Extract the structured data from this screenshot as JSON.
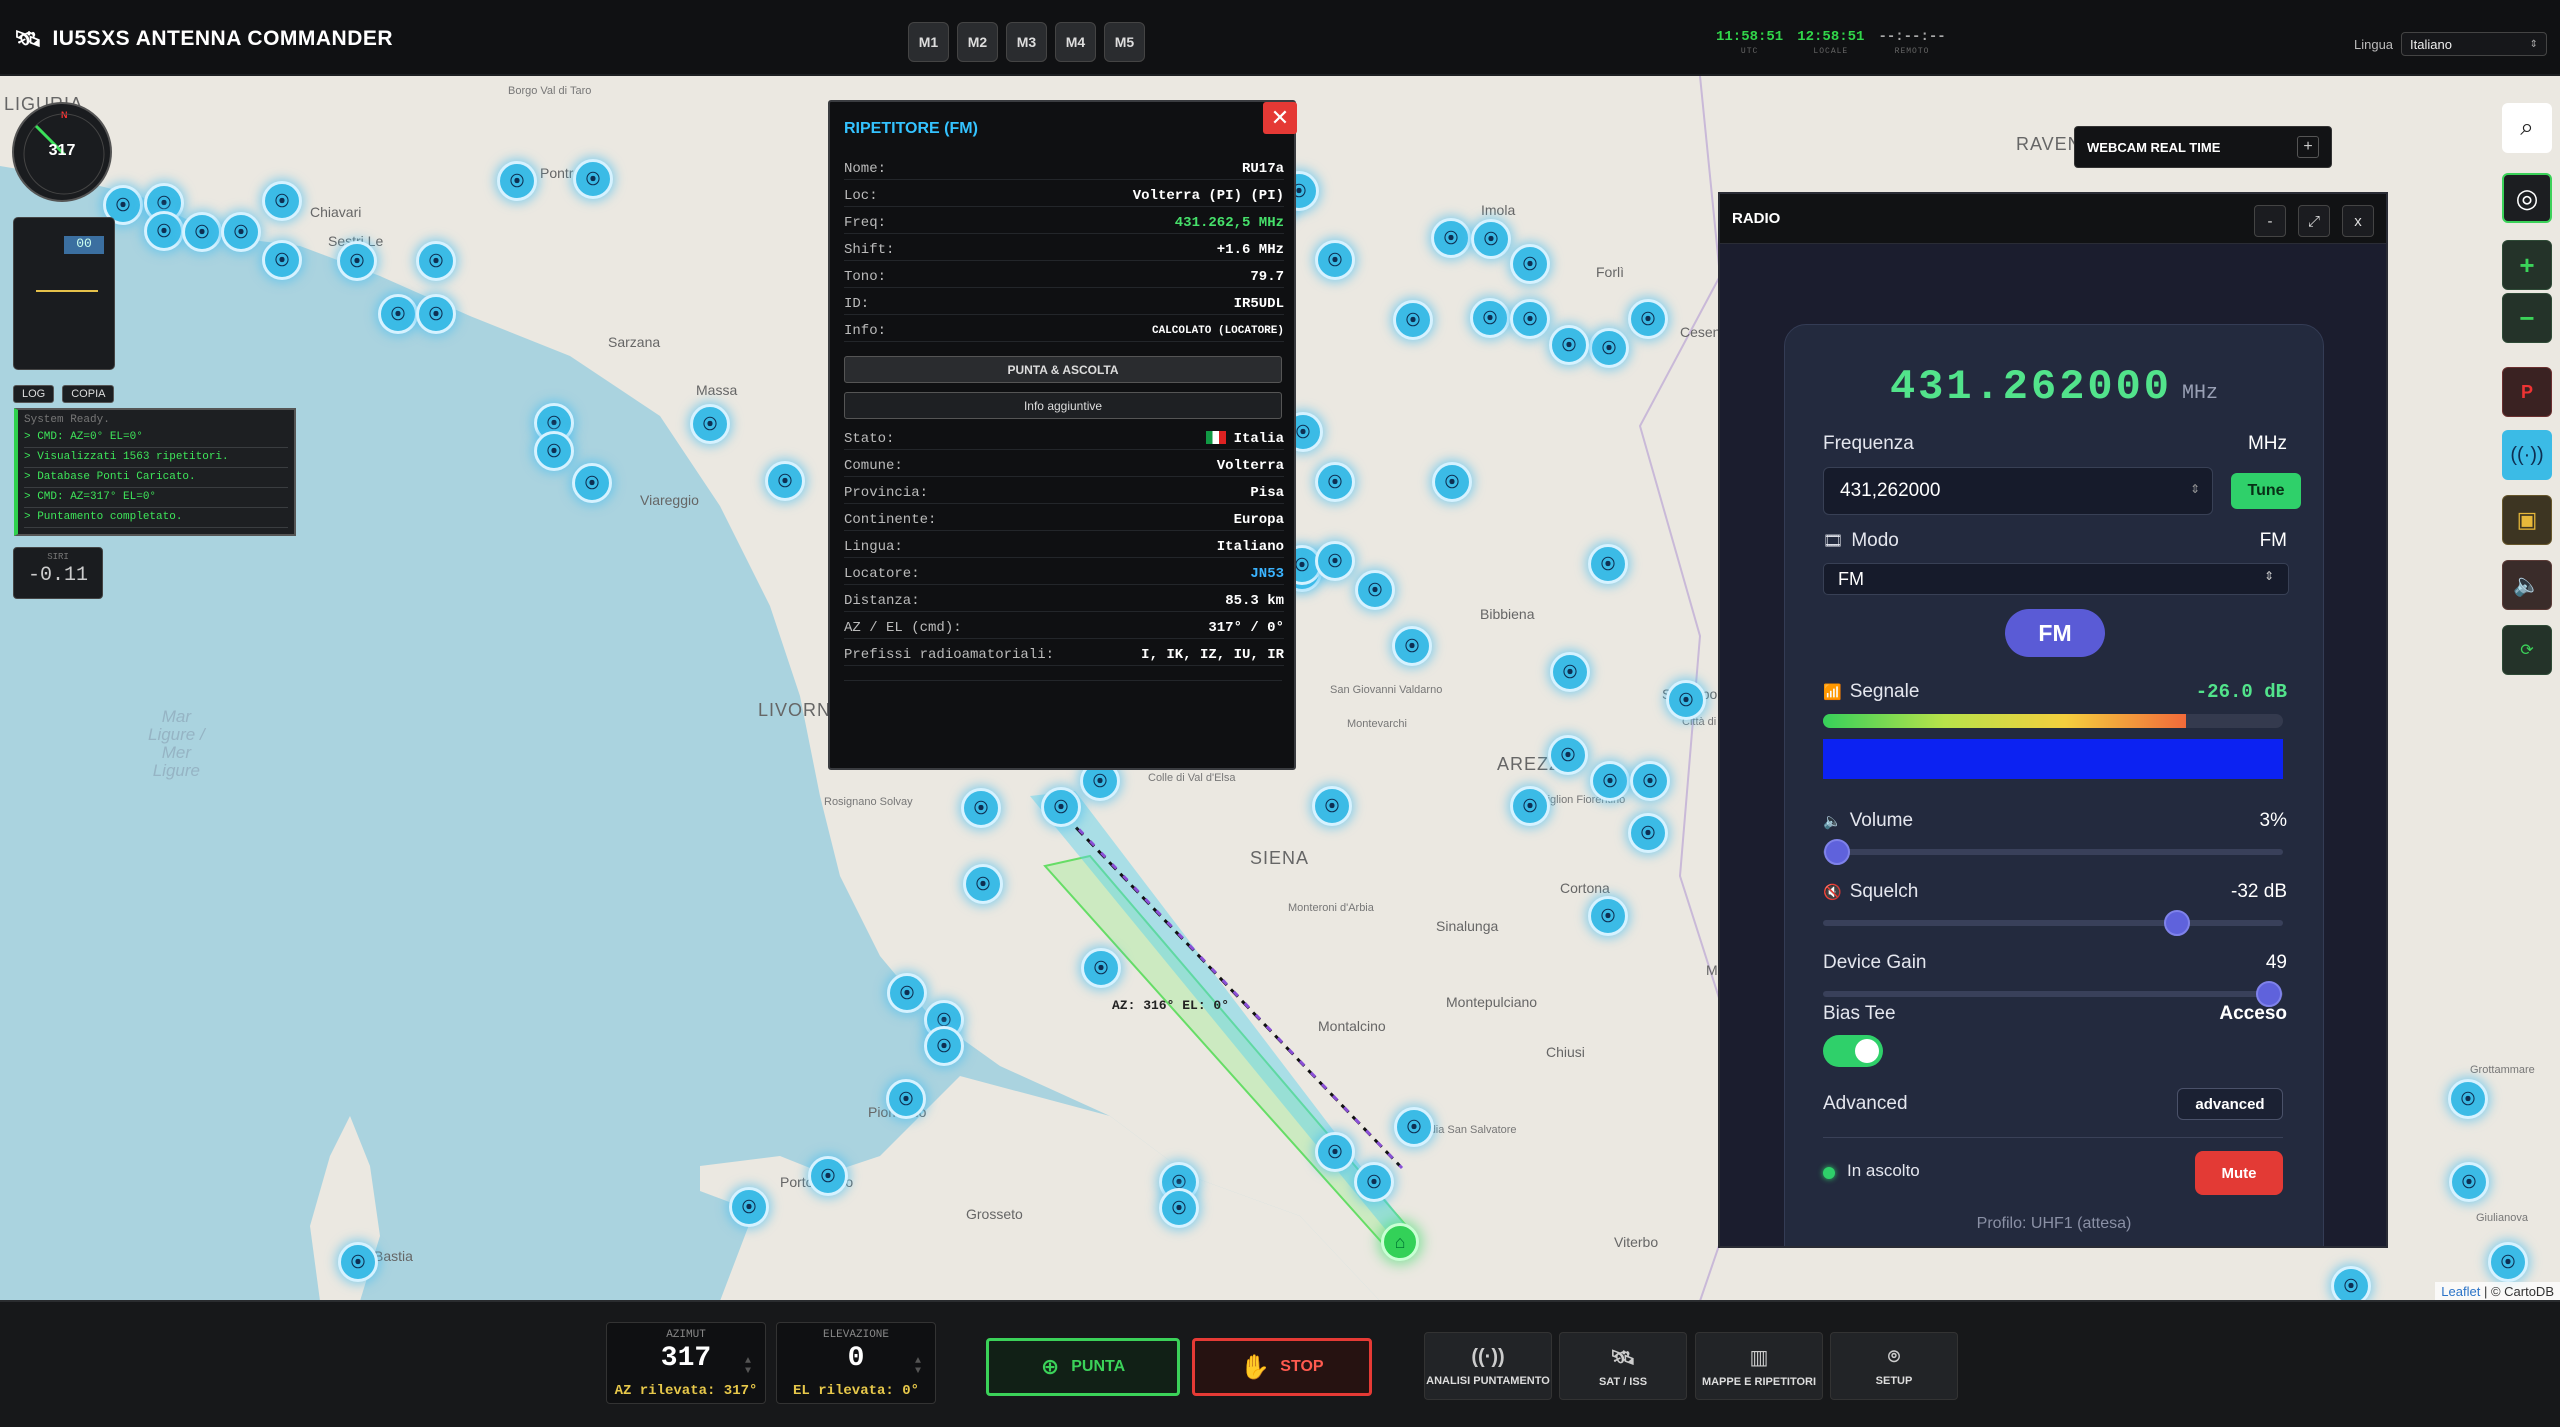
{
  "app": {
    "title": "IU5SXS ANTENNA COMMANDER"
  },
  "memory_buttons": [
    "M1",
    "M2",
    "M3",
    "M4",
    "M5"
  ],
  "clocks": [
    {
      "time": "11:58:51",
      "label": "UTC"
    },
    {
      "time": "12:58:51",
      "label": "LOCALE"
    },
    {
      "time": "--:--:--",
      "label": "REMOTO"
    }
  ],
  "language": {
    "label": "Lingua",
    "value": "Italiano"
  },
  "compass": {
    "azimuth": "317",
    "north": "N"
  },
  "log": {
    "tabs": [
      "LOG",
      "COPIA"
    ],
    "header": "System Ready.",
    "lines": [
      "> CMD: AZ=0° EL=0°",
      "> Visualizzati 1563 ripetitori.",
      "> Database Ponti Caricato.",
      "> CMD: AZ=317° EL=0°",
      "> Puntamento completato."
    ]
  },
  "siri": {
    "label": "SIRI",
    "value": "-0.11"
  },
  "elevation_widget": {
    "value": "00"
  },
  "map": {
    "sea_label": [
      "Mar",
      "Ligure /",
      "Mer",
      "Ligure"
    ],
    "cities": [
      {
        "name": "LIGURIA",
        "cls": "big"
      },
      {
        "name": "RAVENNA",
        "cls": "big"
      },
      {
        "name": "LIVORNO",
        "cls": "big"
      },
      {
        "name": "AREZZO",
        "cls": "big"
      },
      {
        "name": "SIENA",
        "cls": "big"
      },
      {
        "name": "Pontremoli",
        "cls": ""
      },
      {
        "name": "Chiavari",
        "cls": ""
      },
      {
        "name": "Sestri Le",
        "cls": ""
      },
      {
        "name": "Borgo Val di Taro",
        "cls": "small"
      },
      {
        "name": "Sarzana",
        "cls": ""
      },
      {
        "name": "Massa",
        "cls": ""
      },
      {
        "name": "Viareggio",
        "cls": ""
      },
      {
        "name": "Imola",
        "cls": ""
      },
      {
        "name": "Forlì",
        "cls": ""
      },
      {
        "name": "Cesena",
        "cls": ""
      },
      {
        "name": "Bibbiena",
        "cls": ""
      },
      {
        "name": "Sansepolcro",
        "cls": ""
      },
      {
        "name": "San Giovanni Valdarno",
        "cls": "small"
      },
      {
        "name": "Montevarchi",
        "cls": "small"
      },
      {
        "name": "Colle di Val d'Elsa",
        "cls": "small"
      },
      {
        "name": "Rosignano Solvay",
        "cls": "small"
      },
      {
        "name": "Castiglion Fiorentino",
        "cls": "small"
      },
      {
        "name": "Città di Castello",
        "cls": "small"
      },
      {
        "name": "Cortona",
        "cls": ""
      },
      {
        "name": "Monteroni d'Arbia",
        "cls": "small"
      },
      {
        "name": "Sinalunga",
        "cls": ""
      },
      {
        "name": "Montepulciano",
        "cls": ""
      },
      {
        "name": "Montalcino",
        "cls": ""
      },
      {
        "name": "Chiusi",
        "cls": ""
      },
      {
        "name": "Magione",
        "cls": ""
      },
      {
        "name": "Abbadia San Salvatore",
        "cls": "small"
      },
      {
        "name": "Piombino",
        "cls": ""
      },
      {
        "name": "Portoferraio",
        "cls": ""
      },
      {
        "name": "Grosseto",
        "cls": ""
      },
      {
        "name": "Bastia",
        "cls": ""
      },
      {
        "name": "Grottammare",
        "cls": "small"
      },
      {
        "name": "Giulianova",
        "cls": "small"
      },
      {
        "name": "Viterbo",
        "cls": ""
      }
    ],
    "beam_label": "AZ: 316° EL: 0°",
    "attribution_link": "Leaflet",
    "attribution_rest": "| © CartoDB"
  },
  "repeater_popup": {
    "title": "RIPETITORE (FM)",
    "close": "✕",
    "rows": [
      {
        "k": "Nome:",
        "v": "RU17a",
        "style": ""
      },
      {
        "k": "Loc:",
        "v": "Volterra (PI) (PI)",
        "style": ""
      },
      {
        "k": "Freq:",
        "v": "431.262,5 MHz",
        "style": "green"
      },
      {
        "k": "Shift:",
        "v": "+1.6 MHz",
        "style": ""
      },
      {
        "k": "Tono:",
        "v": "79.7",
        "style": ""
      },
      {
        "k": "ID:",
        "v": "IR5UDL",
        "style": ""
      },
      {
        "k": "Info:",
        "v": "CALCOLATO (LOCATORE)",
        "style": "small"
      }
    ],
    "btn_point": "PUNTA & ASCOLTA",
    "btn_info": "Info aggiuntive",
    "details": [
      {
        "k": "Stato:",
        "v": "Italia",
        "style": "flag"
      },
      {
        "k": "Comune:",
        "v": "Volterra",
        "style": ""
      },
      {
        "k": "Provincia:",
        "v": "Pisa",
        "style": ""
      },
      {
        "k": "Continente:",
        "v": "Europa",
        "style": ""
      },
      {
        "k": "Lingua:",
        "v": "Italiano",
        "style": ""
      },
      {
        "k": "Locatore:",
        "v": "JN53",
        "style": "blue"
      },
      {
        "k": "Distanza:",
        "v": "85.3 km",
        "style": ""
      },
      {
        "k": "AZ / EL (cmd):",
        "v": "317° / 0°",
        "style": ""
      },
      {
        "k": "Prefissi radioamatoriali:",
        "v": "I, IK, IZ, IU, IR",
        "style": ""
      }
    ]
  },
  "webcam": {
    "title": "WEBCAM REAL TIME",
    "btn": "+"
  },
  "radio": {
    "title": "RADIO",
    "win_buttons": [
      "-",
      "⤢",
      "x"
    ],
    "freq_display": "431.262000",
    "freq_unit": "MHz",
    "freq_label": "Frequenza",
    "freq_unit_right": "MHz",
    "freq_value": "431,262000",
    "tune": "Tune",
    "mode_label": "Modo",
    "mode_right": "FM",
    "mode_value": "FM",
    "mode_pill": "FM",
    "signal_label": "Segnale",
    "signal_value": "-26.0 dB",
    "signal_level": 0.79,
    "volume_label": "Volume",
    "volume_value": "3%",
    "volume_level": 0.03,
    "squelch_label": "Squelch",
    "squelch_value": "-32 dB",
    "squelch_level": 0.77,
    "gain_label": "Device Gain",
    "gain_value": "49",
    "gain_level": 0.97,
    "bias_label": "Bias Tee",
    "bias_value": "Acceso",
    "advanced_label": "Advanced",
    "advanced_btn": "advanced",
    "status": "In ascolto",
    "mute": "Mute",
    "profile": "Profilo: UHF1 (attesa)"
  },
  "bottom": {
    "azimuth": {
      "label": "AZIMUT",
      "value": "317",
      "sub": "AZ rilevata: 317°"
    },
    "elevation": {
      "label": "ELEVAZIONE",
      "value": "0",
      "sub": "EL rilevata: 0°"
    },
    "punta": "PUNTA",
    "stop": "STOP",
    "nav": [
      "ANALISI PUNTAMENTO",
      "SAT / ISS",
      "MAPPE E RIPETITORI",
      "SETUP"
    ]
  },
  "colors": {
    "accent_green": "#31d64a",
    "repeater_marker": "#3bbbe6",
    "stop_red": "#e63a35",
    "popup_title": "#34c3ff"
  }
}
